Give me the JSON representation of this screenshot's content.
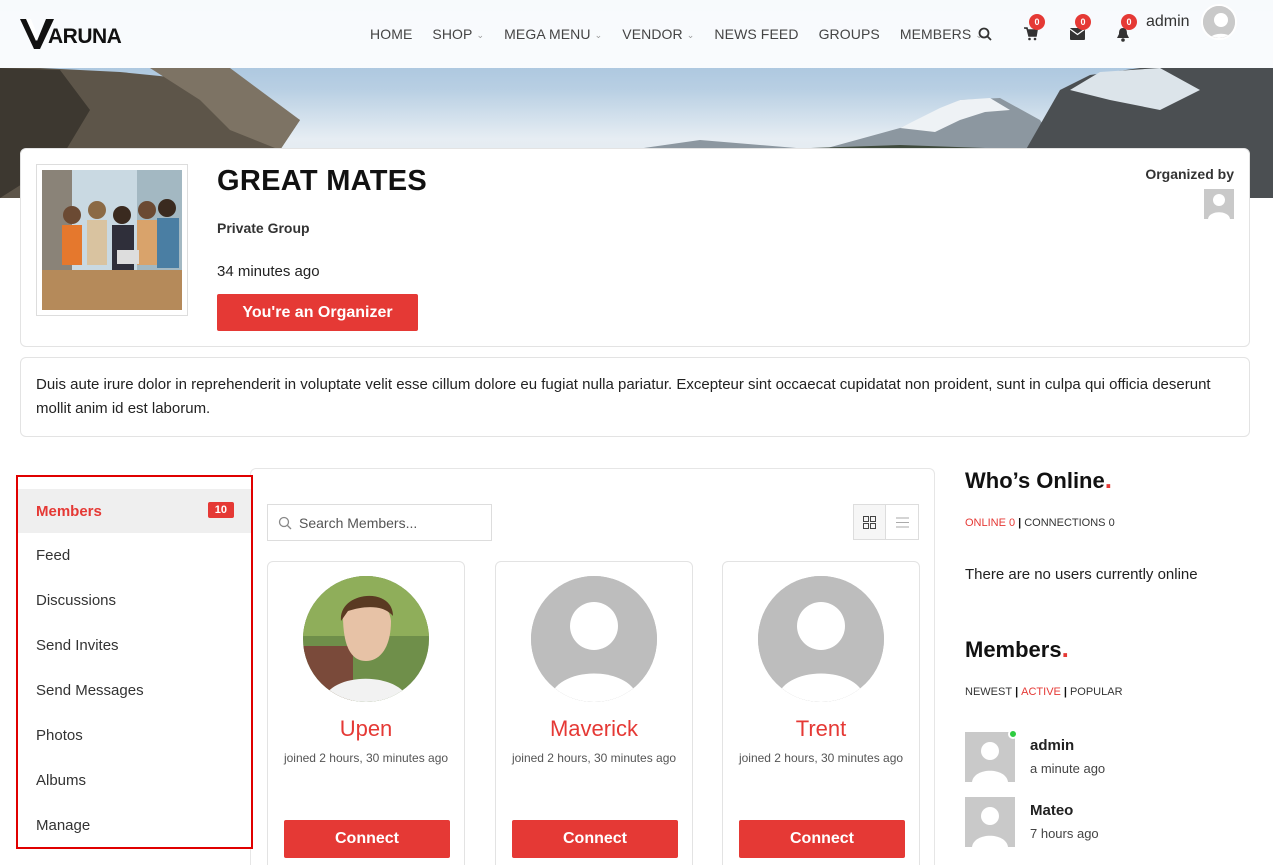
{
  "header": {
    "logo_text": "ARUNA",
    "nav": [
      {
        "label": "HOME",
        "dropdown": false
      },
      {
        "label": "SHOP",
        "dropdown": true
      },
      {
        "label": "MEGA MENU",
        "dropdown": true
      },
      {
        "label": "VENDOR",
        "dropdown": true
      },
      {
        "label": "NEWS FEED",
        "dropdown": false
      },
      {
        "label": "GROUPS",
        "dropdown": false
      },
      {
        "label": "MEMBERS",
        "dropdown": true
      }
    ],
    "cart_count": "0",
    "messages_count": "0",
    "notifications_count": "0",
    "username": "admin"
  },
  "group": {
    "title": "GREAT MATES",
    "type": "Private Group",
    "time": "34 minutes ago",
    "organizer_button": "You're an Organizer",
    "organized_by_label": "Organized by",
    "description": "Duis aute irure dolor in reprehenderit in voluptate velit esse cillum dolore eu fugiat nulla pariatur. Excepteur sint occaecat cupidatat non proident, sunt in culpa qui officia deserunt mollit anim id est laborum."
  },
  "side_menu": {
    "members_label": "Members",
    "members_count": "10",
    "items": [
      "Feed",
      "Discussions",
      "Send Invites",
      "Send Messages",
      "Photos",
      "Albums",
      "Manage"
    ]
  },
  "members_panel": {
    "search_placeholder": "Search Members...",
    "connect_label": "Connect",
    "members": [
      {
        "name": "Upen",
        "joined": "joined 2 hours, 30 minutes ago"
      },
      {
        "name": "Maverick",
        "joined": "joined 2 hours, 30 minutes ago"
      },
      {
        "name": "Trent",
        "joined": "joined 2 hours, 30 minutes ago"
      }
    ]
  },
  "whos_online": {
    "title": "Who’s Online",
    "online_label": "ONLINE",
    "online_count": "0",
    "connections_label": "CONNECTIONS",
    "connections_count": "0",
    "empty_message": "There are no users currently online"
  },
  "members_widget": {
    "title": "Members",
    "filters": [
      "NEWEST",
      "ACTIVE",
      "POPULAR"
    ],
    "active_filter": "ACTIVE",
    "list": [
      {
        "name": "admin",
        "time": "a minute ago",
        "online": true
      },
      {
        "name": "Mateo",
        "time": "7 hours ago",
        "online": false
      }
    ]
  },
  "colors": {
    "accent": "#e53935",
    "online": "#2ecc40"
  }
}
